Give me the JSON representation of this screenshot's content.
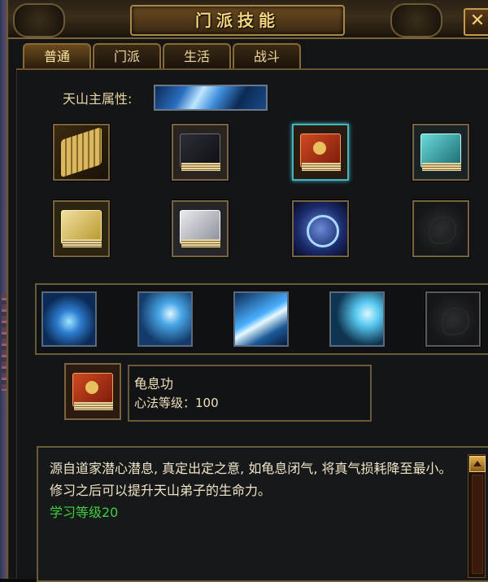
{
  "window": {
    "title": "门派技能",
    "close_label": "✕"
  },
  "tabs": [
    {
      "label": "普通",
      "active": true
    },
    {
      "label": "门派",
      "active": false
    },
    {
      "label": "生活",
      "active": false
    },
    {
      "label": "战斗",
      "active": false
    }
  ],
  "attribute": {
    "label": "天山主属性:"
  },
  "item_grid": [
    {
      "icon": "bamboo-scroll-icon"
    },
    {
      "icon": "dark-book-icon"
    },
    {
      "icon": "red-skill-book-icon",
      "highlighted": true
    },
    {
      "icon": "teal-manual-icon"
    },
    {
      "icon": "yellow-manual-icon"
    },
    {
      "icon": "silver-manual-icon"
    },
    {
      "icon": "blue-skull-scroll-icon"
    },
    {
      "icon": "empty-slot-icon"
    }
  ],
  "skills": [
    {
      "icon": "frost-ring-skill-icon"
    },
    {
      "icon": "ice-fist-skill-icon"
    },
    {
      "icon": "ice-blade-skill-icon"
    },
    {
      "icon": "frost-aura-skill-icon"
    },
    {
      "icon": "empty-skill-slot-icon"
    }
  ],
  "selected": {
    "icon": "red-skill-book-icon",
    "name": "龟息功",
    "level_text": "心法等级：100"
  },
  "description": {
    "text": "源自道家潜心潜息, 真定出定之意, 如龟息闭气, 将真气损耗降至最小。修习之后可以提升天山弟子的生命力。",
    "requirement": "学习等级20"
  },
  "colors": {
    "gold_border": "#7a6440",
    "title_text": "#f4d37a",
    "requirement_text": "#3ecf3e",
    "highlight": "#3fb6c2"
  }
}
